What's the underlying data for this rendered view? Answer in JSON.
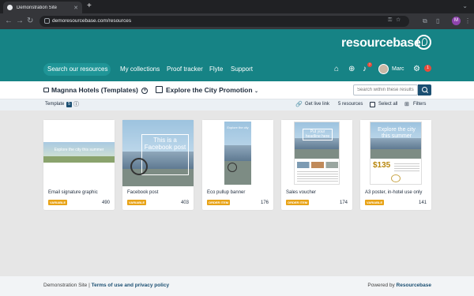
{
  "browser": {
    "tab_title": "Demonstration Site",
    "url": "demoresourcebase.com/resources",
    "profile_initial": "M"
  },
  "header": {
    "logo": "resourcebase",
    "nav": [
      "Search our resources",
      "My collections",
      "Proof tracker",
      "Flyte",
      "Support"
    ],
    "nav_search_chevron": "⌄",
    "notification_count": "7",
    "user_name": "Marc",
    "alert_count": "1"
  },
  "collection": {
    "name": "Magnna Hotels (Templates)",
    "promo_name": "Explore the City Promotion",
    "search_placeholder": "Search within these results"
  },
  "subbar": {
    "template_label": "Template",
    "template_count": "5",
    "get_live_link": "Get live link",
    "resources": "5 resources",
    "select_all": "Select all",
    "filters": "Filters"
  },
  "cards": [
    {
      "caption": "Email signature graphic",
      "tag": "VARIABLE",
      "count": "490",
      "overlay": "Explore the city this summer"
    },
    {
      "caption": "Facebook post",
      "tag": "VARIABLE",
      "count": "403",
      "overlay": "This is a Facebook post"
    },
    {
      "caption": "Eco pullup banner",
      "tag": "ORDER ITEM",
      "count": "176",
      "overlay": "Explore the city"
    },
    {
      "caption": "Sales voucher",
      "tag": "ORDER ITEM",
      "count": "174",
      "overlay": "Put your headline here"
    },
    {
      "caption": "A3 poster, in-hotel use only",
      "tag": "VARIABLE",
      "count": "141",
      "overlay": "Explore the city this summer",
      "price": "$135"
    }
  ],
  "footer": {
    "site": "Demonstration Site |",
    "terms": "Terms of use and privacy policy",
    "powered": "Powered by",
    "brand": "Resourcebase"
  },
  "colors": {
    "header": "#168385",
    "accent": "#1b4f72",
    "tag": "#e8a317"
  }
}
